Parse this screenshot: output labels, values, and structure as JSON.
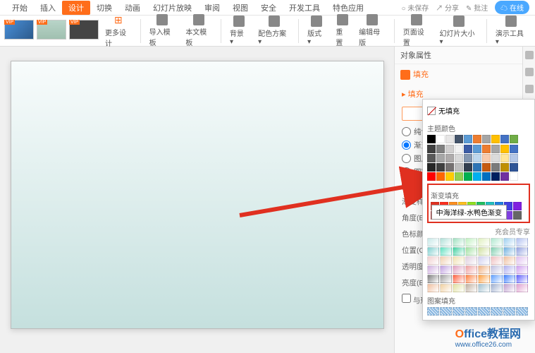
{
  "menu": {
    "tabs": [
      "开始",
      "插入",
      "设计",
      "切换",
      "动画",
      "幻灯片放映",
      "审阅",
      "视图",
      "安全",
      "开发工具",
      "特色应用"
    ],
    "active_index": 2,
    "right": {
      "unsaved": "未保存",
      "share": "分享",
      "annotate": "批注",
      "cloud": "在线"
    }
  },
  "ribbon": {
    "more_design": "更多设计",
    "import_template": "导入模板",
    "local_template": "本文模板",
    "background": "背景 ▾",
    "color_scheme": "配色方案 ▾",
    "layout": "版式 ▾",
    "reset": "重置",
    "edit_master": "编辑母版",
    "page_setup": "页面设置",
    "slide_size": "幻灯片大小 ▾",
    "show_tools": "演示工具 ▾"
  },
  "panel": {
    "title": "对象属性",
    "tab": "填充",
    "section": "▸ 填充",
    "fill_options": {
      "none": "无填充",
      "solid": "纯色填充(S)",
      "gradient": "渐变填充(G)",
      "picture": "图片或纹理填",
      "pattern": "图案填充(P)",
      "hide_bg": "隐藏背景图形"
    },
    "selected_fill": "gradient",
    "rows": {
      "grad_style": "渐变样式(R)",
      "angle": "角度(E)",
      "stop_color": "色标颜色(C)",
      "position": "位置(O)",
      "transparency": "透明度(T)",
      "brightness": "亮度(B)",
      "rotate_with": "与形状一起旋"
    }
  },
  "popup": {
    "no_fill": "无填充",
    "theme_colors": "主题颜色",
    "gradient_fill": "渐变填充",
    "member": "充会员专享",
    "pattern_fill": "图案填充",
    "tooltip": "中海洋绿-水鸭色渐变",
    "theme_row1": [
      "#000000",
      "#ffffff"
    ],
    "std_colors": [
      [
        "#404040",
        "#7f7f7f",
        "#d0cece",
        "#f2f2f2",
        "#3b5ba5",
        "#5b9bd5",
        "#ed7d31",
        "#a5a5a5",
        "#ffc000",
        "#4472c4"
      ],
      [
        "#595959",
        "#a6a6a6",
        "#aeabab",
        "#d9d9d9",
        "#8497b0",
        "#bdd7ee",
        "#f8cbad",
        "#dbdbdb",
        "#ffe699",
        "#b4c7e7"
      ],
      [
        "#262626",
        "#3f3f3f",
        "#757171",
        "#bfbfbf",
        "#333f50",
        "#2e75b6",
        "#c55a11",
        "#7b7b7b",
        "#bf9000",
        "#2f5597"
      ],
      [
        "#ff0000",
        "#ff6600",
        "#ffcc00",
        "#92d050",
        "#00b050",
        "#00b0f0",
        "#0070c0",
        "#002060",
        "#7030a0",
        "#ffffff"
      ]
    ],
    "gradient_swatches": [
      [
        "#e03020",
        "#ff3020",
        "#ff9020",
        "#ffc020",
        "#90e020",
        "#20c060",
        "#20c0c0",
        "#2080e0",
        "#4040e0",
        "#8020e0"
      ],
      [
        "#c04040",
        "#e06040",
        "#e0a040",
        "#c0c040",
        "#60c060",
        "#40c0a0",
        "#40a0e0",
        "#4060e0",
        "#8040e0",
        "#666666"
      ]
    ],
    "member_grads": [
      [
        "#c8e8e8",
        "#b0e0d8",
        "#a0e0c0",
        "#c0f0c0",
        "#e0f0c0",
        "#b0e8d0",
        "#a0d0f0",
        "#b0c0f0"
      ],
      [
        "#80d0d0",
        "#60e0c0",
        "#40d0a0",
        "#a0e0a0",
        "#d0e0a0",
        "#80d0b0",
        "#70b0e0",
        "#90a0e0"
      ],
      [
        "#f0d0d0",
        "#f0d0b0",
        "#f0e0b0",
        "#e0d0e0",
        "#d0d0f0",
        "#f0c0c0",
        "#f0c0a0",
        "#e0c0f0"
      ],
      [
        "#d0b0e0",
        "#c0a0e0",
        "#e0a0c0",
        "#f0a0a0",
        "#f0b080",
        "#c0c0e0",
        "#b0b0f0",
        "#d0a0f0"
      ],
      [
        "#808080",
        "#a0a0a0",
        "#ff6040",
        "#ff8040",
        "#ffa040",
        "#60a0ff",
        "#4080ff",
        "#6060ff"
      ],
      [
        "#f0c0a0",
        "#f0d0a0",
        "#e0e0a0",
        "#c0b0a0",
        "#a0c0d0",
        "#a0b0d0",
        "#c0a0d0",
        "#e0a0d0"
      ]
    ],
    "pattern_colors": [
      "#5b9bd5",
      "#5b9bd5",
      "#5b9bd5",
      "#5b9bd5",
      "#5b9bd5",
      "#5b9bd5",
      "#5b9bd5",
      "#5b9bd5"
    ]
  },
  "watermark": {
    "brand": "Office教程网",
    "url": "www.office26.com"
  }
}
